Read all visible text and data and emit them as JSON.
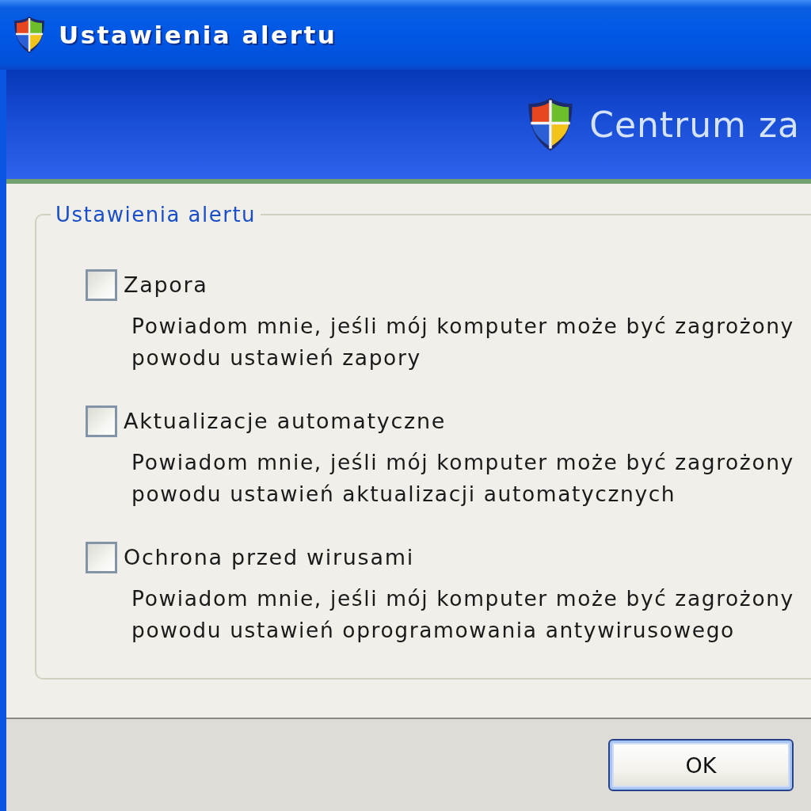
{
  "window": {
    "title": "Ustawienia alertu"
  },
  "banner": {
    "title": "Centrum za"
  },
  "group": {
    "legend": "Ustawienia alertu",
    "options": [
      {
        "label": "Zapora",
        "checked": false,
        "description": [
          "Powiadom mnie, jeśli mój komputer może być zagrożony",
          "powodu ustawień zapory"
        ]
      },
      {
        "label": "Aktualizacje automatyczne",
        "checked": false,
        "description": [
          "Powiadom mnie, jeśli mój komputer może być zagrożony",
          "powodu ustawień aktualizacji automatycznych"
        ]
      },
      {
        "label": "Ochrona przed wirusami",
        "checked": false,
        "description": [
          "Powiadom mnie, jeśli mój komputer może być zagrożony",
          "powodu ustawień oprogramowania antywirusowego"
        ]
      }
    ]
  },
  "buttons": [
    {
      "label": "OK",
      "default": true
    }
  ]
}
